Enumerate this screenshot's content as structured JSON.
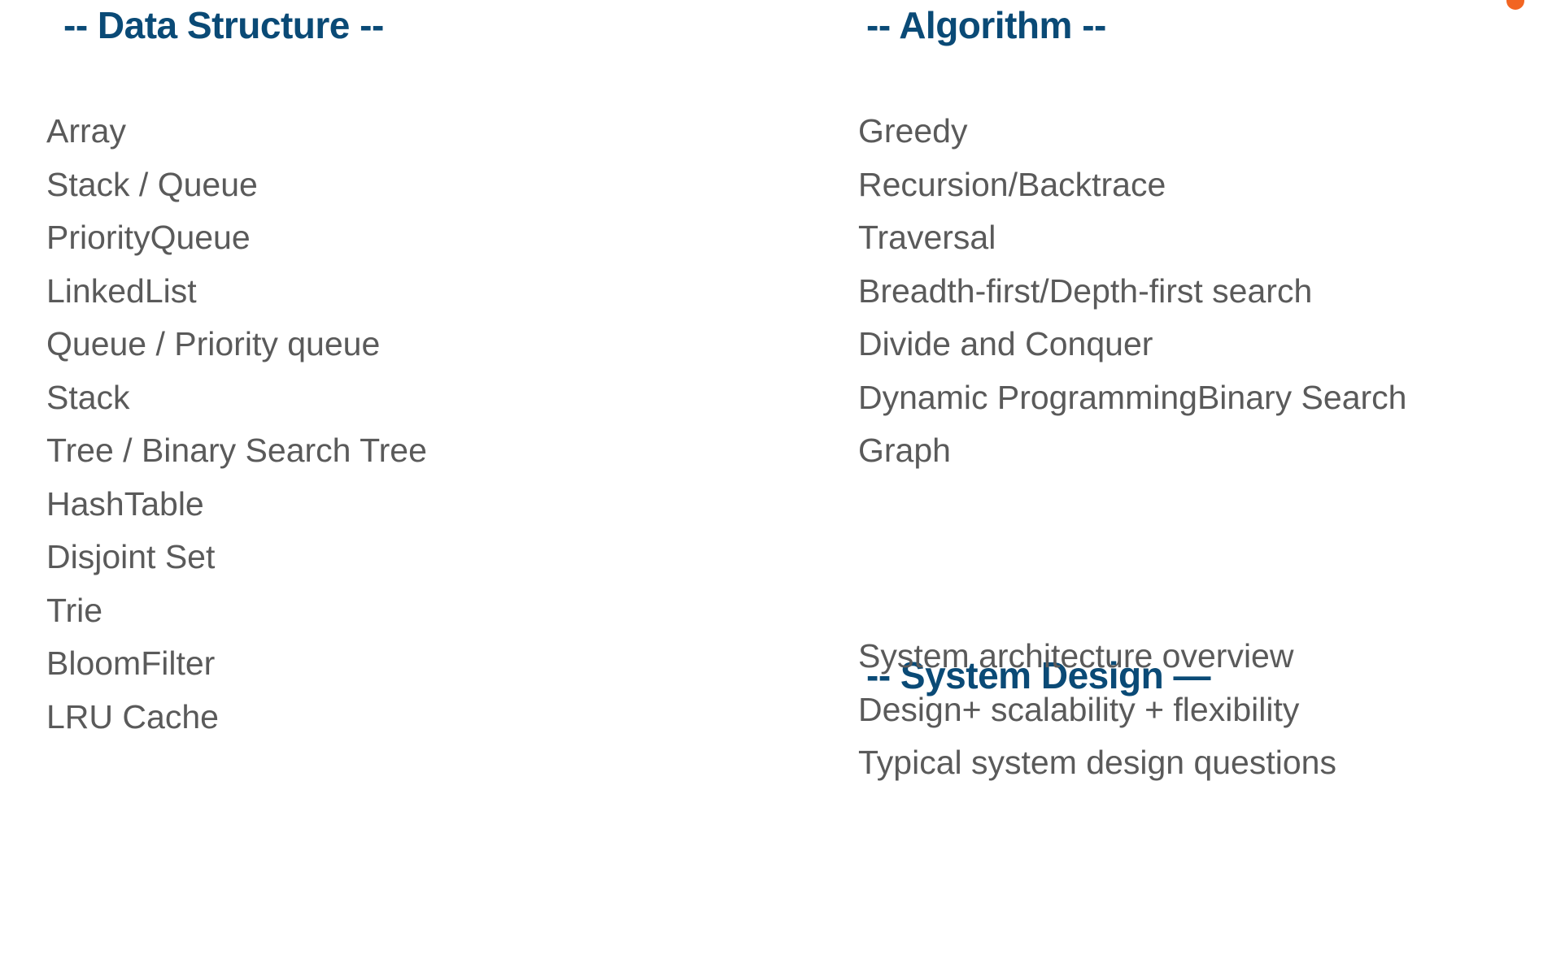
{
  "accent_color": "#f26522",
  "heading_color": "#0a4a76",
  "body_color": "#5a5a5a",
  "columns": {
    "left": {
      "heading": "-- Data Structure --",
      "items": [
        "Array",
        "Stack / Queue",
        "PriorityQueue",
        "LinkedList",
        "Queue / Priority queue",
        "Stack",
        "Tree / Binary Search Tree",
        "HashTable",
        "Disjoint Set",
        "Trie",
        "BloomFilter",
        "LRU Cache"
      ]
    },
    "right": {
      "algorithm": {
        "heading": "-- Algorithm --",
        "items": [
          "Greedy",
          "Recursion/Backtrace",
          "Traversal",
          "Breadth-first/Depth-first search",
          "Divide and Conquer",
          "Dynamic ProgrammingBinary Search",
          "Graph"
        ]
      },
      "system_design": {
        "heading": "-- System Design —",
        "items": [
          "System architecture overview",
          "Design+ scalability + flexibility",
          "Typical system design questions"
        ]
      }
    }
  }
}
